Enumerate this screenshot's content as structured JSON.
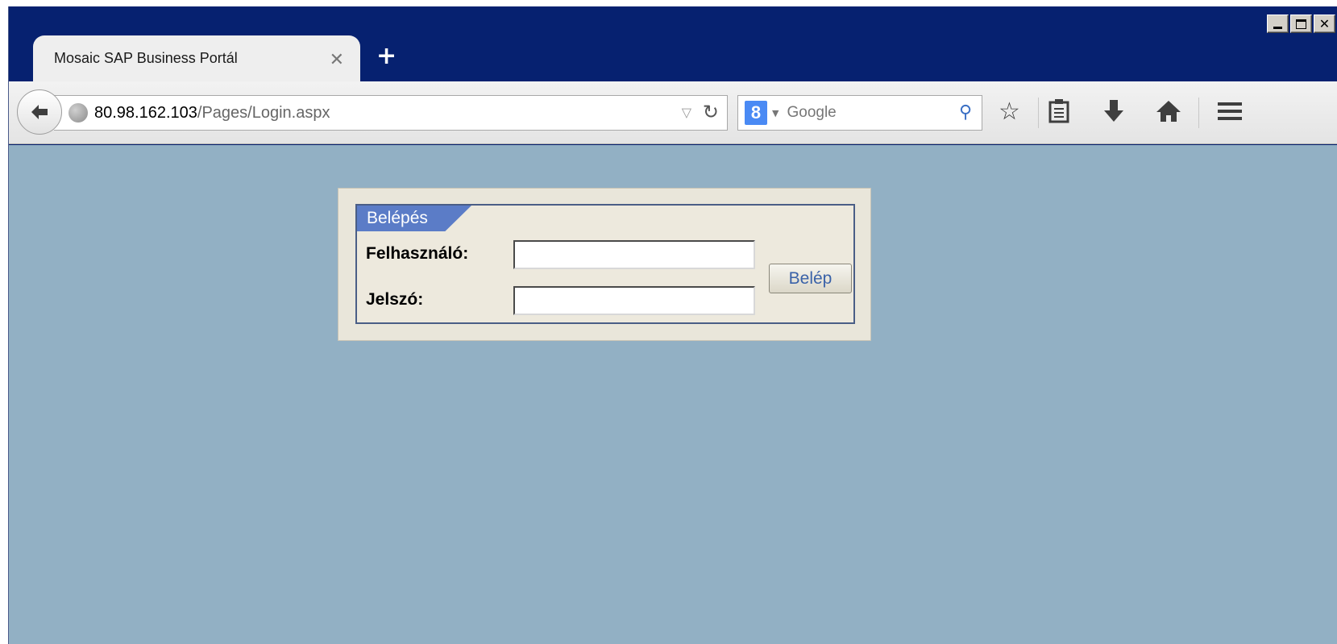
{
  "browser": {
    "tab_title": "Mosaic SAP Business Portál",
    "tab_close": "✕",
    "new_tab": "+",
    "url_host": "80.98.162.103",
    "url_path": "/Pages/Login.aspx",
    "search_engine_badge": "8",
    "search_placeholder": "Google",
    "icons": [
      "back-icon",
      "globe-icon",
      "dropdown-icon",
      "reload-icon",
      "search-icon",
      "bookmark-star-icon",
      "reading-list-icon",
      "download-icon",
      "home-icon",
      "menu-icon"
    ]
  },
  "window_controls": {
    "close": "✕"
  },
  "login": {
    "tab_title": "Belépés",
    "username_label": "Felhasználó:",
    "username_value": "",
    "password_label": "Jelszó:",
    "password_value": "",
    "submit_label": "Belép"
  },
  "colors": {
    "titlebar": "#062170",
    "page_background": "#92b0c4",
    "login_tab": "#5b7cc7"
  }
}
